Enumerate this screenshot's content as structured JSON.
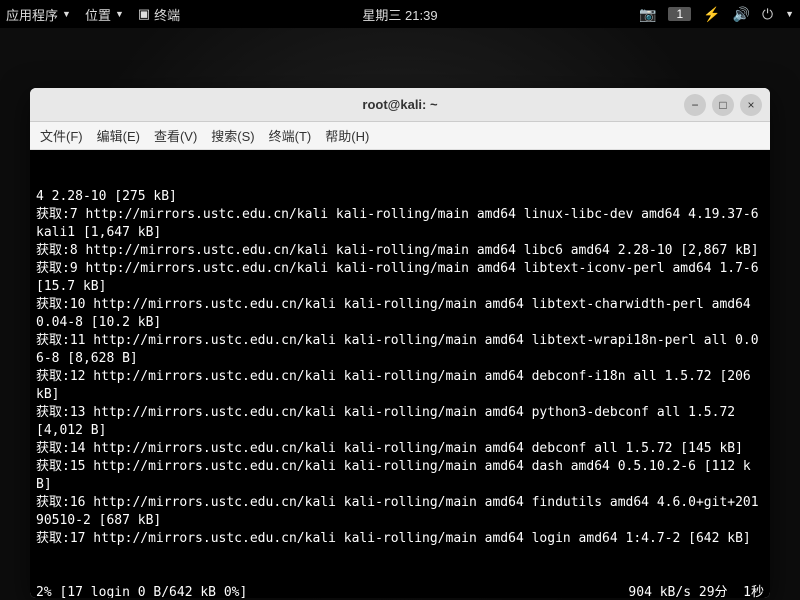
{
  "topbar": {
    "apps": "应用程序",
    "places": "位置",
    "terminal_launcher": "终端",
    "clock": "星期三 21:39",
    "workspace": "1"
  },
  "window": {
    "title": "root@kali: ~",
    "menu": {
      "file": "文件(F)",
      "edit": "编辑(E)",
      "view": "查看(V)",
      "search": "搜索(S)",
      "terminal": "终端(T)",
      "help": "帮助(H)"
    }
  },
  "terminal": {
    "lines": [
      "4 2.28-10 [275 kB]",
      "获取:7 http://mirrors.ustc.edu.cn/kali kali-rolling/main amd64 linux-libc-dev amd64 4.19.37-6kali1 [1,647 kB]",
      "获取:8 http://mirrors.ustc.edu.cn/kali kali-rolling/main amd64 libc6 amd64 2.28-10 [2,867 kB]",
      "获取:9 http://mirrors.ustc.edu.cn/kali kali-rolling/main amd64 libtext-iconv-perl amd64 1.7-6 [15.7 kB]",
      "获取:10 http://mirrors.ustc.edu.cn/kali kali-rolling/main amd64 libtext-charwidth-perl amd64 0.04-8 [10.2 kB]",
      "获取:11 http://mirrors.ustc.edu.cn/kali kali-rolling/main amd64 libtext-wrapi18n-perl all 0.06-8 [8,628 B]",
      "获取:12 http://mirrors.ustc.edu.cn/kali kali-rolling/main amd64 debconf-i18n all 1.5.72 [206 kB]",
      "获取:13 http://mirrors.ustc.edu.cn/kali kali-rolling/main amd64 python3-debconf all 1.5.72 [4,012 B]",
      "获取:14 http://mirrors.ustc.edu.cn/kali kali-rolling/main amd64 debconf all 1.5.72 [145 kB]",
      "获取:15 http://mirrors.ustc.edu.cn/kali kali-rolling/main amd64 dash amd64 0.5.10.2-6 [112 kB]",
      "获取:16 http://mirrors.ustc.edu.cn/kali kali-rolling/main amd64 findutils amd64 4.6.0+git+20190510-2 [687 kB]",
      "获取:17 http://mirrors.ustc.edu.cn/kali kali-rolling/main amd64 login amd64 1:4.7-2 [642 kB]"
    ],
    "status_left": "2% [17 login 0 B/642 kB 0%]",
    "status_right": "904 kB/s 29分  1秒"
  }
}
